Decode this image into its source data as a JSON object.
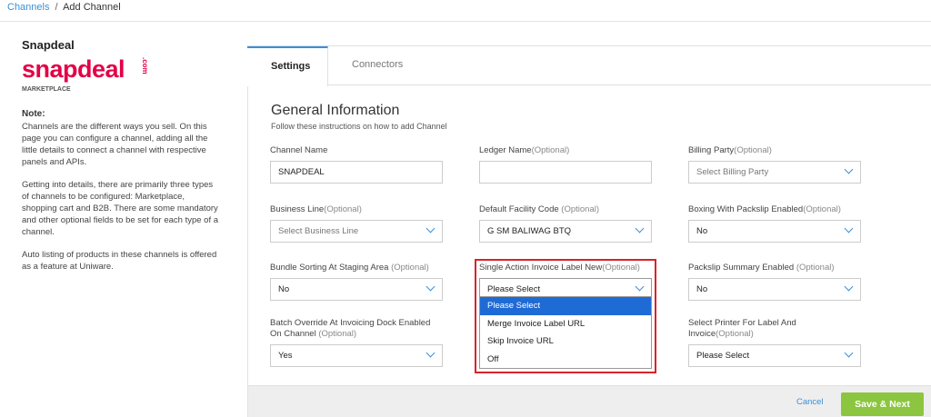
{
  "breadcrumb": {
    "parent": "Channels",
    "separator": "/",
    "current": "Add Channel"
  },
  "channel": {
    "name": "Snapdeal",
    "logo_text": "snapdeal",
    "logo_suffix": ".com",
    "type": "MARKETPLACE",
    "brand_color": "#e40046"
  },
  "note": {
    "heading": "Note:",
    "paragraphs": [
      "Channels are the different ways you sell. On this page you can configure a channel, adding all the little details to connect a channel with respective panels and APIs.",
      "Getting into details, there are primarily three types of channels to be configured: Marketplace, shopping cart and B2B. There are some mandatory and other optional fields to be set for each type of a channel.",
      "Auto listing of products in these channels is offered as a feature at Uniware."
    ]
  },
  "tabs": [
    {
      "label": "Settings",
      "active": true
    },
    {
      "label": "Connectors",
      "active": false
    }
  ],
  "section": {
    "title": "General Information",
    "subtitle": "Follow these instructions on how to add Channel"
  },
  "fields": {
    "channel_name": {
      "label": "Channel Name",
      "optional": "",
      "value": "SNAPDEAL"
    },
    "ledger_name": {
      "label": "Ledger Name",
      "optional": "(Optional)",
      "value": ""
    },
    "billing_party": {
      "label": "Billing Party",
      "optional": "(Optional)",
      "value": "Select Billing Party"
    },
    "business_line": {
      "label": "Business Line",
      "optional": "(Optional)",
      "value": "Select Business Line"
    },
    "default_facility": {
      "label": "Default Facility Code ",
      "optional": "(Optional)",
      "value": "G SM BALIWAG BTQ"
    },
    "boxing_packslip": {
      "label": "Boxing With Packslip Enabled",
      "optional": "(Optional)",
      "value": "No"
    },
    "bundle_sorting": {
      "label": "Bundle Sorting At Staging Area ",
      "optional": "(Optional)",
      "value": "No"
    },
    "single_action_invoice": {
      "label": "Single Action Invoice Label New",
      "optional": "(Optional)",
      "value": "Please Select"
    },
    "packslip_summary": {
      "label": "Packslip Summary Enabled ",
      "optional": "(Optional)",
      "value": "No"
    },
    "batch_override": {
      "label": "Batch Override At Invoicing Dock Enabled On Channel ",
      "optional": "(Optional)",
      "value": "Yes"
    },
    "select_printer": {
      "label": "Select Printer For Label And Invoice",
      "optional": "(Optional)",
      "value": "Please Select"
    }
  },
  "dropdown_options": [
    "Please Select",
    "Merge Invoice Label URL",
    "Skip Invoice URL",
    "Off"
  ],
  "footer": {
    "cancel": "Cancel",
    "save": "Save & Next"
  },
  "colors": {
    "accent": "#3b8fd6",
    "highlight": "#d8232a",
    "save_button": "#8cc53f",
    "selected_option": "#1e6bd6"
  }
}
